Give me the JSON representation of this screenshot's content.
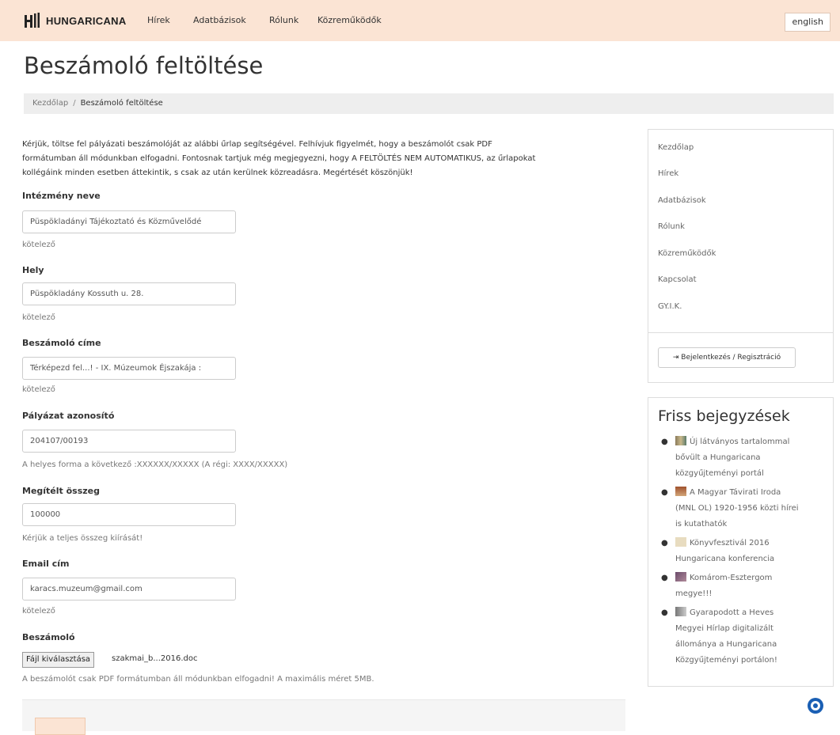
{
  "navbar": {
    "brand": "HUNGARICANA",
    "links": [
      "Hírek",
      "Adatbázisok",
      "Rólunk",
      "Közreműködők"
    ],
    "lang": "english"
  },
  "page": {
    "title": "Beszámoló feltöltése",
    "breadcrumb": {
      "home": "Kezdőlap",
      "separator": "/",
      "current": "Beszámoló feltöltése"
    },
    "intro": [
      "Kérjük, töltse fel pályázati beszámolóját az alábbi űrlap segítségével. Felhívjuk figyelmét, hogy a beszámolót csak PDF",
      "formátumban áll módunkban elfogadni. Fontosnak tartjuk még megjegyezni, hogy A FELTÖLTÉS NEM AUTOMATIKUS, az űrlapokat",
      "kollégáink minden esetben áttekintik, s csak az után kerülnek közreadásra. Megértését köszönjük!"
    ]
  },
  "form": {
    "institution": {
      "label": "Intézmény neve",
      "value": "Püspökladányi Tájékoztató és Közművelődé",
      "help": "kötelező"
    },
    "place": {
      "label": "Hely",
      "value": "Püspökladány Kossuth u. 28.",
      "help": "kötelező"
    },
    "report_title": {
      "label": "Beszámoló címe",
      "value": "Térképezd fel...! - IX. Múzeumok Éjszakája :",
      "help": "kötelező"
    },
    "grant_id": {
      "label": "Pályázat azonosító",
      "value": "204107/00193",
      "help": "A helyes forma a következő :XXXXXX/XXXXX (A régi: XXXX/XXXXX)"
    },
    "amount": {
      "label": "Megítélt összeg",
      "value": "100000",
      "help": "Kérjük a teljes összeg kiírását!"
    },
    "email": {
      "label": "Email cím",
      "value": "karacs.muzeum@gmail.com",
      "help": "kötelező"
    },
    "report": {
      "label": "Beszámoló",
      "button": "Fájl kiválasztása",
      "filename": "szakmai_b...2016.doc",
      "help": "A beszámolót csak PDF formátumban áll módunkban elfogadni! A maximális méret 5MB."
    }
  },
  "sidebar": {
    "links": [
      "Kezdőlap",
      "Hírek",
      "Adatbázisok",
      "Rólunk",
      "Közreműködők",
      "Kapcsolat",
      "GY.I.K."
    ],
    "login": "Bejelentkezés / Regisztráció",
    "recent_title": "Friss bejegyzések",
    "recent_posts": [
      [
        "Új látványos tartalommal",
        "bővült a Hungaricana",
        "közgyűjteményi portál"
      ],
      [
        "A Magyar Távirati Iroda",
        "(MNL OL) 1920-1956 közti hírei",
        "is kutathatók"
      ],
      [
        "Könyvfesztivál 2016",
        "Hungaricana konferencia"
      ],
      [
        "Komárom-Esztergom",
        "megye!!!"
      ],
      [
        "Gyarapodott a Heves",
        "Megyei Hírlap digitalizált",
        "állománya a Hungaricana",
        "Közgyűjteményi portálon!"
      ]
    ]
  },
  "colors": {
    "navbar_bg": "#fbe4d4",
    "breadcrumb_bg": "#eeeeee"
  }
}
